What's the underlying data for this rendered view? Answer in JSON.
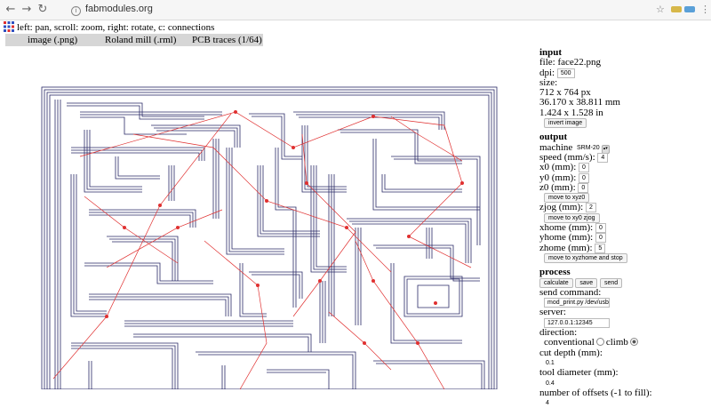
{
  "browser": {
    "url": "fabmodules.org"
  },
  "instructions": "left: pan, scroll: zoom, right: rotate, c: connections",
  "tabs": [
    {
      "label": "image (.png)"
    },
    {
      "label": "Roland mill (.rml)"
    },
    {
      "label": "PCB traces (1/64)"
    }
  ],
  "input": {
    "heading": "input",
    "file_label": "file: face22.png",
    "dpi_label": "dpi:",
    "dpi_value": "500",
    "size_label": "size:",
    "size_px": "712 x 764 px",
    "size_mm": "36.170 x 38.811 mm",
    "size_in": "1.424 x 1.528 in",
    "invert_button": "invert image"
  },
  "output": {
    "heading": "output",
    "machine_label": "machine",
    "machine_value": "SRM-20",
    "speed_label": "speed (mm/s):",
    "speed_value": "4",
    "x0_label": "x0 (mm):",
    "x0_value": "0",
    "y0_label": "y0 (mm):",
    "y0_value": "0",
    "z0_label": "z0 (mm):",
    "z0_value": "0",
    "move_xyz0_button": "move to xyz0",
    "zjog_label": "zjog (mm):",
    "zjog_value": "2",
    "move_xy0_zjog_button": "move to xy0 zjog",
    "xhome_label": "xhome (mm):",
    "xhome_value": "0",
    "yhome_label": "yhome (mm):",
    "yhome_value": "0",
    "zhome_label": "zhome (mm):",
    "zhome_value": "5",
    "move_home_button": "move to xyzhome and stop"
  },
  "process": {
    "heading": "process",
    "calculate_button": "calculate",
    "save_button": "save",
    "send_button": "send",
    "send_command_label": "send command:",
    "send_command_value": "mod_print.py /dev/usb/lp",
    "server_label": "server:",
    "server_value": "127.0.0.1:12345",
    "direction_label": "direction:",
    "conventional_label": "conventional",
    "climb_label": "climb",
    "cut_depth_label": "cut depth (mm):",
    "cut_depth_value": "0.1",
    "tool_diameter_label": "tool diameter (mm):",
    "tool_diameter_value": "0.4",
    "offsets_label": "number of offsets (-1 to fill):",
    "offsets_value": "4"
  },
  "colors": {
    "toolpath": "#2a2a66",
    "connections": "#e03030",
    "tabbar": "#d6d6d6"
  }
}
